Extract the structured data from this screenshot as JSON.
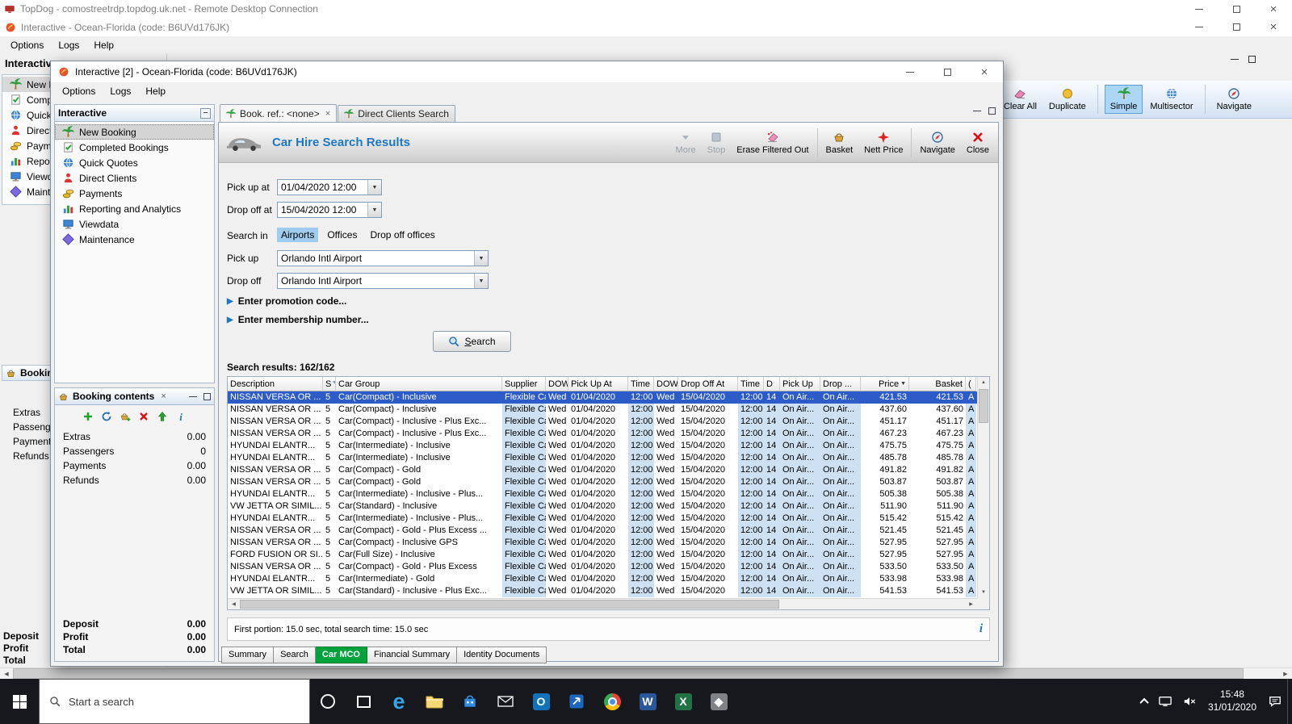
{
  "rdp_bar": {
    "title": "TopDog - comostreetrdp.topdog.uk.net - Remote Desktop Connection"
  },
  "app_bar": {
    "title": "Interactive - Ocean-Florida (code: B6UVd176JK)"
  },
  "app_menu": {
    "items": [
      "Options",
      "Logs",
      "Help"
    ]
  },
  "background": {
    "left_panel_title": "Interactive",
    "booking_panel_title": "Booking contents",
    "booking_rows": [
      "Extras",
      "Passengers",
      "Payments",
      "Refunds"
    ],
    "totals": [
      "Deposit",
      "Profit",
      "Total"
    ],
    "right_toolbar": [
      {
        "label": "Clear All",
        "icon": "eraser"
      },
      {
        "label": "Duplicate",
        "icon": "coin"
      },
      {
        "divider": true
      },
      {
        "label": "Simple",
        "icon": "palm",
        "selected": true
      },
      {
        "label": "Multisector",
        "icon": "globe"
      },
      {
        "divider": true
      },
      {
        "label": "Navigate",
        "icon": "compass"
      }
    ]
  },
  "dialog": {
    "title": "Interactive [2] - Ocean-Florida (code: B6UVd176JK)",
    "menu": [
      "Options",
      "Logs",
      "Help"
    ],
    "nav": {
      "title": "Interactive",
      "selected_index": 0,
      "items": [
        {
          "label": "New Booking",
          "icon": "palm"
        },
        {
          "label": "Completed Bookings",
          "icon": "check"
        },
        {
          "label": "Quick Quotes",
          "icon": "globeclock"
        },
        {
          "label": "Direct Clients",
          "icon": "person"
        },
        {
          "label": "Payments",
          "icon": "coins"
        },
        {
          "label": "Reporting and Analytics",
          "icon": "chart"
        },
        {
          "label": "Viewdata",
          "icon": "monitor"
        },
        {
          "label": "Maintenance",
          "icon": "diamond"
        }
      ]
    },
    "booking_contents": {
      "title": "Booking contents",
      "toolbar": [
        {
          "name": "add",
          "icon": "plus"
        },
        {
          "name": "refresh",
          "icon": "refresh"
        },
        {
          "name": "add-to-basket",
          "icon": "basketadd"
        },
        {
          "name": "delete",
          "icon": "delred"
        },
        {
          "name": "export",
          "icon": "upgreen"
        },
        {
          "name": "info",
          "icon": "info"
        }
      ],
      "rows": [
        {
          "label": "Extras",
          "value": "0.00"
        },
        {
          "label": "Passengers",
          "value": "0"
        },
        {
          "label": "Payments",
          "value": "0.00"
        },
        {
          "label": "Refunds",
          "value": "0.00"
        }
      ],
      "totals": [
        {
          "label": "Deposit",
          "value": "0.00"
        },
        {
          "label": "Profit",
          "value": "0.00"
        },
        {
          "label": "Total",
          "value": "0.00"
        }
      ]
    },
    "tabs": [
      {
        "label": "Book. ref.: <none>",
        "active": true,
        "closable": true
      },
      {
        "label": "Direct Clients Search",
        "active": false
      }
    ],
    "page_title": "Car Hire Search Results",
    "toolbar": [
      {
        "label": "More",
        "icon": "more",
        "disabled": true
      },
      {
        "label": "Stop",
        "icon": "stop",
        "disabled": true
      },
      {
        "label": "Erase Filtered Out",
        "icon": "erasef"
      },
      {
        "divider": true
      },
      {
        "label": "Basket",
        "icon": "basket"
      },
      {
        "label": "Nett Price",
        "icon": "nett"
      },
      {
        "divider": true
      },
      {
        "label": "Navigate",
        "icon": "compass"
      },
      {
        "label": "Close",
        "icon": "closered"
      }
    ],
    "form": {
      "rows": [
        {
          "label": "Pick up at",
          "value": "01/04/2020 12:00"
        },
        {
          "label": "Drop off at",
          "value": "15/04/2020 12:00"
        }
      ],
      "search_in_label": "Search in",
      "search_in": [
        "Airports",
        "Offices",
        "Drop off offices"
      ],
      "search_in_selected": 0,
      "location_rows": [
        {
          "label": "Pick up",
          "value": "Orlando Intl Airport"
        },
        {
          "label": "Drop off",
          "value": "Orlando Intl Airport"
        }
      ],
      "expanders": [
        "Enter promotion code...",
        "Enter membership number..."
      ],
      "search_button": "Search"
    },
    "results_summary": "Search results: 162/162",
    "table": {
      "columns": [
        "Description",
        "S",
        "Car Group",
        "Supplier",
        "DOW",
        "Pick Up At",
        "Time",
        "DOW",
        "Drop Off At",
        "Time",
        "D",
        "Pick Up",
        "Drop ...",
        "Price",
        "Basket",
        "("
      ],
      "sort_column": "Price",
      "selected_row": 0,
      "row_common": {
        "s": "5",
        "supplier": "Flexible Car...",
        "dow1": "Wed",
        "pickup_date": "01/04/2020",
        "time1": "12:00",
        "dow2": "Wed",
        "dropoff_date": "15/04/2020",
        "time2": "12:00",
        "d": "14",
        "pickup_loc": "On Air...",
        "dropoff_loc": "On Air...",
        "last": "A"
      },
      "rows": [
        [
          "NISSAN VERSA OR ...",
          "Car(Compact) - Inclusive",
          "421.53",
          "421.53"
        ],
        [
          "NISSAN VERSA OR ...",
          "Car(Compact) - Inclusive",
          "437.60",
          "437.60"
        ],
        [
          "NISSAN VERSA OR ...",
          "Car(Compact) - Inclusive - Plus Exc...",
          "451.17",
          "451.17"
        ],
        [
          "NISSAN VERSA OR ...",
          "Car(Compact) - Inclusive - Plus Exc...",
          "467.23",
          "467.23"
        ],
        [
          "HYUNDAI ELANTR...",
          "Car(Intermediate) - Inclusive",
          "475.75",
          "475.75"
        ],
        [
          "HYUNDAI ELANTR...",
          "Car(Intermediate) - Inclusive",
          "485.78",
          "485.78"
        ],
        [
          "NISSAN VERSA OR ...",
          "Car(Compact) - Gold",
          "491.82",
          "491.82"
        ],
        [
          "NISSAN VERSA OR ...",
          "Car(Compact) - Gold",
          "503.87",
          "503.87"
        ],
        [
          "HYUNDAI ELANTR...",
          "Car(Intermediate) - Inclusive - Plus...",
          "505.38",
          "505.38"
        ],
        [
          "VW JETTA OR SIMIL...",
          "Car(Standard) - Inclusive",
          "511.90",
          "511.90"
        ],
        [
          "HYUNDAI ELANTR...",
          "Car(Intermediate) - Inclusive - Plus...",
          "515.42",
          "515.42"
        ],
        [
          "NISSAN VERSA OR ...",
          "Car(Compact) - Gold - Plus Excess ...",
          "521.45",
          "521.45"
        ],
        [
          "NISSAN VERSA OR ...",
          "Car(Compact) - Inclusive GPS",
          "527.95",
          "527.95"
        ],
        [
          "FORD FUSION OR SI...",
          "Car(Full Size) - Inclusive",
          "527.95",
          "527.95"
        ],
        [
          "NISSAN VERSA OR ...",
          "Car(Compact) - Gold - Plus Excess",
          "533.50",
          "533.50"
        ],
        [
          "HYUNDAI ELANTR...",
          "Car(Intermediate) - Gold",
          "533.98",
          "533.98"
        ],
        [
          "VW JETTA OR SIMIL...",
          "Car(Standard) - Inclusive - Plus Exc...",
          "541.53",
          "541.53"
        ]
      ]
    },
    "status": "First portion: 15.0 sec, total search time: 15.0 sec",
    "info_glyph": "i",
    "bottom_tabs": [
      "Summary",
      "Search",
      "Car MCO",
      "Financial Summary",
      "Identity Documents"
    ],
    "bottom_tab_active": 2
  },
  "taskbar": {
    "search_placeholder": "Start a search",
    "app_icons": [
      "edge",
      "explorer",
      "store",
      "mail",
      "outlook",
      "blueapp",
      "chrome",
      "word",
      "excel",
      "grayapp"
    ],
    "clock_time": "15:48",
    "clock_date": "31/01/2020"
  },
  "colors": {
    "accent_blue": "#1d77c4",
    "selection_blue": "#2d5cc8",
    "cell_highlight": "#cde1f3",
    "active_tab_green": "#00a23c",
    "toolbar_selected_blue": "#abd6f5"
  }
}
